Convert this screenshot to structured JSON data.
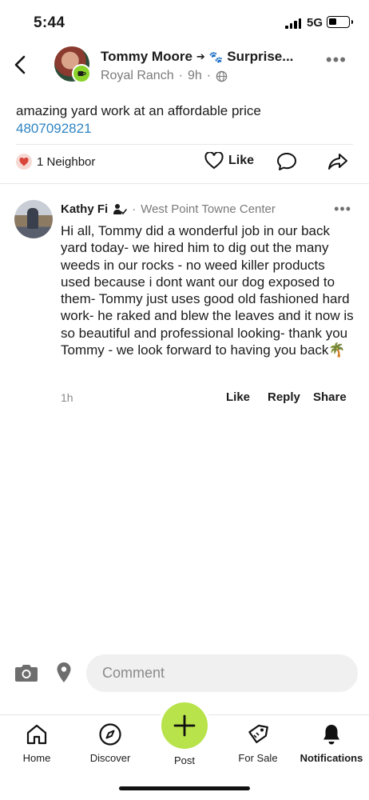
{
  "status_bar": {
    "time": "5:44",
    "network": "5G",
    "icons": [
      "signal-icon",
      "battery-icon"
    ]
  },
  "post": {
    "author": "Tommy Moore",
    "group": "Surprise...",
    "neighborhood": "Royal Ranch",
    "time": "9h",
    "text": "amazing yard work at an affordable price",
    "phone": "4807092821",
    "reactions_label": "1 Neighbor",
    "like_label": "Like"
  },
  "comment": {
    "author": "Kathy Fi",
    "neighborhood": "West Point Towne Center",
    "body": "Hi all, Tommy did a wonderful job in our back yard today- we hired him to dig out the many weeds in our rocks - no weed killer products used because i dont want our dog exposed to them- Tommy just uses good old fashioned hard work- he raked and blew the leaves and it now is so beautiful and professional looking- thank you Tommy - we look forward to having you back🌴",
    "time": "1h",
    "actions": {
      "like": "Like",
      "reply": "Reply",
      "share": "Share"
    }
  },
  "composer": {
    "placeholder": "Comment"
  },
  "nav": {
    "home": "Home",
    "discover": "Discover",
    "post": "Post",
    "for_sale": "For Sale",
    "notifications": "Notifications"
  },
  "colors": {
    "accent_green": "#b8e34a",
    "badge_green": "#8bd32a",
    "link_blue": "#2f84c4",
    "heart_red": "#d9453b"
  }
}
